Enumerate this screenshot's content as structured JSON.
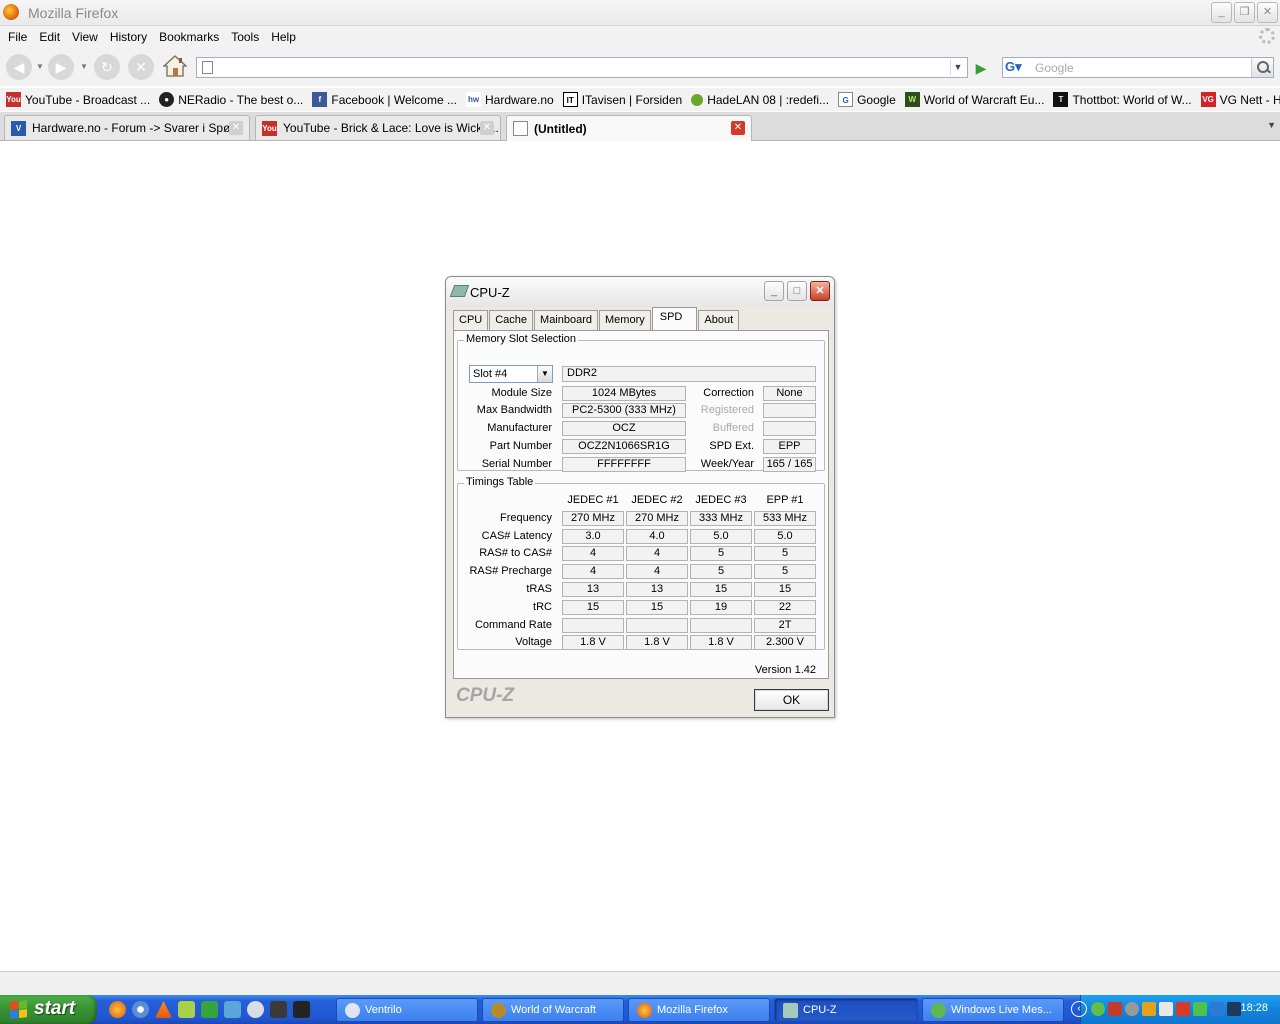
{
  "browser": {
    "title": "Mozilla Firefox",
    "menu": [
      "File",
      "Edit",
      "View",
      "History",
      "Bookmarks",
      "Tools",
      "Help"
    ],
    "url": "",
    "search_placeholder": "Google",
    "bookmarks": [
      {
        "label": "YouTube - Broadcast ...",
        "icon": "youtube-icon"
      },
      {
        "label": "NERadio - The best o...",
        "icon": "radio-icon"
      },
      {
        "label": "Facebook | Welcome ...",
        "icon": "facebook-icon"
      },
      {
        "label": "Hardware.no",
        "icon": "hardware-icon"
      },
      {
        "label": "ITavisen | Forsiden",
        "icon": "itavisen-icon"
      },
      {
        "label": "HadeLAN 08 | :redefi...",
        "icon": "hadelan-icon"
      },
      {
        "label": "Google",
        "icon": "google-icon"
      },
      {
        "label": "World of Warcraft Eu...",
        "icon": "wow-icon"
      },
      {
        "label": "Thottbot: World of W...",
        "icon": "thottbot-icon"
      },
      {
        "label": "VG Nett - Hovedsiden",
        "icon": "vg-icon"
      }
    ],
    "tabs": [
      {
        "label": "Hardware.no - Forum -> Svarer i Spør...",
        "icon": "hardware-icon"
      },
      {
        "label": "YouTube - Brick & Lace: Love is Wicke...",
        "icon": "youtube-icon"
      },
      {
        "label": "(Untitled)",
        "icon": "page-icon"
      }
    ]
  },
  "cpuz": {
    "title": "CPU-Z",
    "tabs": [
      "CPU",
      "Cache",
      "Mainboard",
      "Memory",
      "SPD",
      "About"
    ],
    "active_tab": "SPD",
    "slot_group_label": "Memory Slot Selection",
    "slot": "Slot #4",
    "mem_type": "DDR2",
    "left_fields": [
      {
        "label": "Module Size",
        "value": "1024 MBytes"
      },
      {
        "label": "Max Bandwidth",
        "value": "PC2-5300 (333 MHz)"
      },
      {
        "label": "Manufacturer",
        "value": "OCZ"
      },
      {
        "label": "Part Number",
        "value": "OCZ2N1066SR1G"
      },
      {
        "label": "Serial Number",
        "value": "FFFFFFFF"
      }
    ],
    "right_fields": [
      {
        "label": "Correction",
        "value": "None"
      },
      {
        "label": "Registered",
        "value": ""
      },
      {
        "label": "Buffered",
        "value": ""
      },
      {
        "label": "SPD Ext.",
        "value": "EPP"
      },
      {
        "label": "Week/Year",
        "value": "165 / 165"
      }
    ],
    "timings_label": "Timings Table",
    "timing_columns": [
      "JEDEC #1",
      "JEDEC #2",
      "JEDEC #3",
      "EPP #1"
    ],
    "timing_rows": [
      {
        "label": "Frequency",
        "values": [
          "270 MHz",
          "270 MHz",
          "333 MHz",
          "533 MHz"
        ]
      },
      {
        "label": "CAS# Latency",
        "values": [
          "3.0",
          "4.0",
          "5.0",
          "5.0"
        ]
      },
      {
        "label": "RAS# to CAS#",
        "values": [
          "4",
          "4",
          "5",
          "5"
        ]
      },
      {
        "label": "RAS# Precharge",
        "values": [
          "4",
          "4",
          "5",
          "5"
        ]
      },
      {
        "label": "tRAS",
        "values": [
          "13",
          "13",
          "15",
          "15"
        ]
      },
      {
        "label": "tRC",
        "values": [
          "15",
          "15",
          "19",
          "22"
        ]
      },
      {
        "label": "Command Rate",
        "values": [
          "",
          "",
          "",
          "2T"
        ]
      },
      {
        "label": "Voltage",
        "values": [
          "1.8 V",
          "1.8 V",
          "1.8 V",
          "2.300 V"
        ]
      }
    ],
    "version": "Version 1.42",
    "brand": "CPU-Z",
    "ok_label": "OK"
  },
  "taskbar": {
    "start_label": "start",
    "tasks": [
      {
        "label": "Ventrilo",
        "icon": "ventrilo-icon"
      },
      {
        "label": "World of Warcraft",
        "icon": "wow-icon"
      },
      {
        "label": "Mozilla Firefox",
        "icon": "firefox-icon"
      },
      {
        "label": "CPU-Z",
        "icon": "cpuz-icon"
      },
      {
        "label": "Windows Live Mes...",
        "icon": "messenger-icon"
      }
    ],
    "active_task": "CPU-Z",
    "clock": "18:28"
  }
}
